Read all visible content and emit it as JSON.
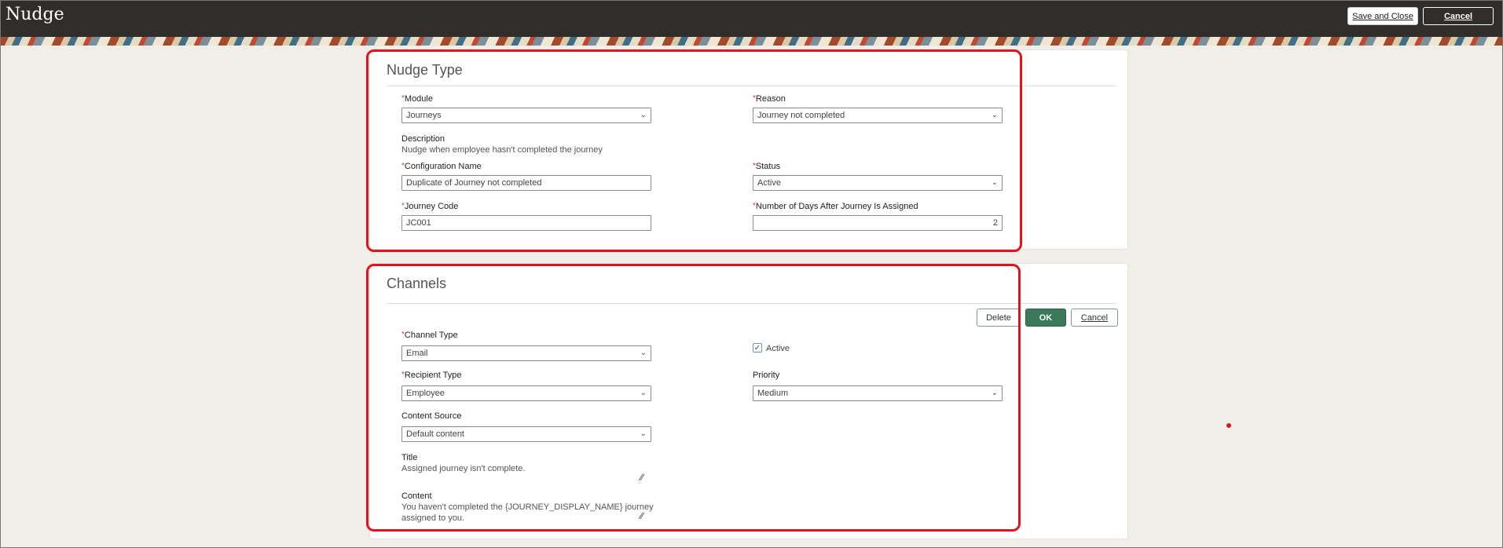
{
  "header": {
    "title": "Nudge",
    "save_close": "Save and Close",
    "cancel": "Cancel"
  },
  "nudge_type": {
    "title": "Nudge Type",
    "required_mark": "*",
    "module": {
      "label": "Module",
      "value": "Journeys"
    },
    "reason": {
      "label": "Reason",
      "value": "Journey not completed"
    },
    "description": {
      "label": "Description",
      "value": "Nudge when employee hasn't completed the journey"
    },
    "config_name": {
      "label": "Configuration Name",
      "value": "Duplicate of Journey not completed"
    },
    "status": {
      "label": "Status",
      "value": "Active"
    },
    "journey_code": {
      "label": "Journey Code",
      "value": "JC001"
    },
    "days_after": {
      "label": "Number of Days After Journey Is Assigned",
      "value": "2"
    }
  },
  "channels": {
    "title": "Channels",
    "delete": "Delete",
    "ok": "OK",
    "cancel": "Cancel",
    "channel_type": {
      "label": "Channel Type",
      "value": "Email"
    },
    "active": {
      "label": "Active",
      "checked": true
    },
    "recipient_type": {
      "label": "Recipient Type",
      "value": "Employee"
    },
    "priority": {
      "label": "Priority",
      "value": "Medium"
    },
    "content_source": {
      "label": "Content Source",
      "value": "Default content"
    },
    "title_field": {
      "label": "Title",
      "value": "Assigned journey isn't complete."
    },
    "content": {
      "label": "Content",
      "line1": "You haven't completed the {JOURNEY_DISPLAY_NAME} journey",
      "line2": "assigned to you."
    }
  },
  "icons": {
    "chevron": "chevron-down-icon",
    "check": "check-icon",
    "resize": "resize-handle-icon"
  },
  "colors": {
    "header_bg": "#312d2a",
    "highlight": "#e0141e",
    "ok_button": "#3a7a5a",
    "required": "#c74634"
  }
}
